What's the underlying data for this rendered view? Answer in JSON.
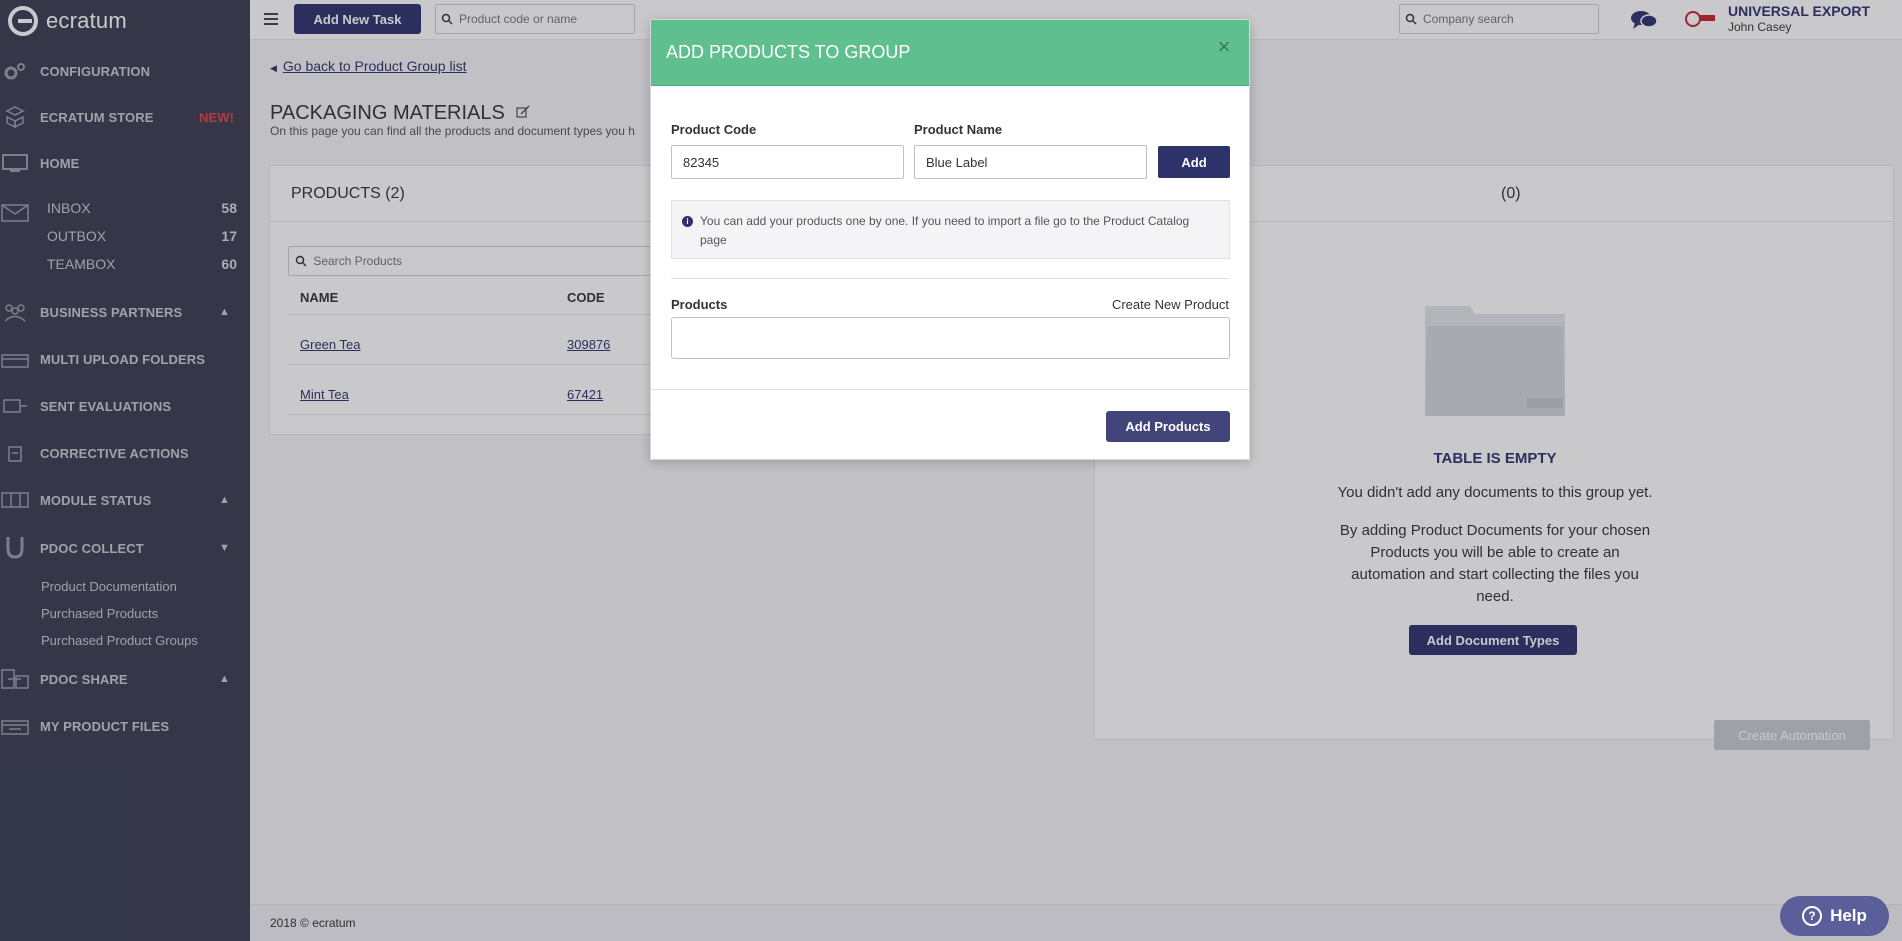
{
  "brand": {
    "name": "ecratum"
  },
  "sidebar": {
    "nav": [
      {
        "label": "CONFIGURATION",
        "icon": "gear-icon"
      },
      {
        "label": "ECRATUM STORE",
        "icon": "cubes-icon",
        "badge": "NEW!"
      },
      {
        "label": "HOME",
        "icon": "monitor-icon"
      }
    ],
    "mail": [
      {
        "label": "INBOX",
        "count": "58"
      },
      {
        "label": "OUTBOX",
        "count": "17"
      },
      {
        "label": "TEAMBOX",
        "count": "60"
      }
    ],
    "sections": [
      {
        "label": "BUSINESS PARTNERS",
        "icon": "partners-icon",
        "chevron": "up"
      },
      {
        "label": "MULTI UPLOAD FOLDERS",
        "icon": "folders-icon"
      },
      {
        "label": "SENT EVALUATIONS",
        "icon": "evaluations-icon"
      },
      {
        "label": "CORRECTIVE ACTIONS",
        "icon": "actions-icon"
      },
      {
        "label": "MODULE STATUS",
        "icon": "module-icon",
        "chevron": "up"
      },
      {
        "label": "PDOC COLLECT",
        "icon": "magnet-icon",
        "chevron": "down"
      }
    ],
    "pdoc_collect_links": [
      "Product Documentation",
      "Purchased Products",
      "Purchased Product Groups"
    ],
    "bottom": [
      {
        "label": "PDOC SHARE",
        "icon": "share-icon",
        "chevron": "up"
      },
      {
        "label": "MY PRODUCT FILES",
        "icon": "files-icon"
      }
    ]
  },
  "topbar": {
    "new_task_label": "Add New Task",
    "product_search_placeholder": "Product code or name",
    "company_search_placeholder": "Company search",
    "company_name": "UNIVERSAL EXPORT",
    "user_name": "John Casey"
  },
  "page": {
    "back_link": "Go back to Product Group list",
    "title": "PACKAGING MATERIALS",
    "description": "On this page you can find all the products and document types you h"
  },
  "products_panel": {
    "title": "PRODUCTS (2)",
    "search_placeholder": "Search Products",
    "columns": {
      "name": "NAME",
      "code": "CODE"
    },
    "rows": [
      {
        "name": "Green Tea",
        "code": "309876"
      },
      {
        "name": "Mint Tea",
        "code": "67421"
      }
    ]
  },
  "docs_panel": {
    "title_suffix": "(0)",
    "empty_title": "TABLE IS EMPTY",
    "empty_text1": "You didn't add any documents to this group yet.",
    "empty_text2": "By adding Product Documents for your chosen Products you will be able to create an automation and start collecting the files you need.",
    "add_doc_types_label": "Add Document Types",
    "create_automation_label": "Create Automation"
  },
  "footer": {
    "text": "2018 © ecratum"
  },
  "modal": {
    "title": "ADD PRODUCTS TO GROUP",
    "close": "×",
    "product_code_label": "Product Code",
    "product_code_value": "82345",
    "product_name_label": "Product Name",
    "product_name_value": "Blue Label",
    "add_label": "Add",
    "info_text": "You can add your products one by one. If you need to import a file go to the Product Catalog page",
    "products_label": "Products",
    "create_new_product": "Create New Product",
    "add_products_label": "Add Products"
  },
  "help": {
    "label": "Help"
  },
  "colors": {
    "accent": "#2e326b",
    "modal_header": "#5fbf8e",
    "sidebar": "#3a3d4f",
    "badge": "#e34040"
  }
}
